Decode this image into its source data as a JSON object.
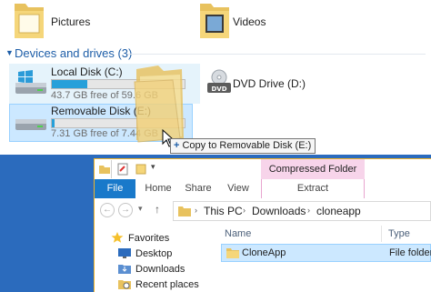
{
  "libraries": [
    {
      "label": "Pictures",
      "icon": "pictures-folder-icon"
    },
    {
      "label": "Videos",
      "icon": "videos-folder-icon"
    }
  ],
  "devices_group": {
    "title": "Devices and drives (3)"
  },
  "drives": [
    {
      "name": "Local Disk (C:)",
      "free_text": "43.7 GB free of 59.6 GB",
      "used_fraction": 0.27,
      "icon": "windows-drive-icon"
    },
    {
      "name": "DVD Drive (D:)",
      "icon": "dvd-drive-icon"
    },
    {
      "name": "Removable Disk (E:)",
      "free_text": "7.31 GB free of 7.44 GB",
      "used_fraction": 0.02,
      "icon": "removable-drive-icon"
    }
  ],
  "drag": {
    "tooltip": "Copy to Removable Disk (E:)",
    "tooltip_icon": "plus-icon"
  },
  "window": {
    "contextual_tab": "Compressed Folder Tools",
    "ribbon_tabs": [
      "File",
      "Home",
      "Share",
      "View",
      "Extract"
    ],
    "breadcrumb": [
      "This PC",
      "Downloads",
      "cloneapp"
    ],
    "nav": {
      "favorites": "Favorites",
      "items": [
        "Desktop",
        "Downloads",
        "Recent places"
      ]
    },
    "columns": {
      "name": "Name",
      "type": "Type"
    },
    "rows": [
      {
        "name": "CloneApp",
        "type": "File folder"
      }
    ]
  },
  "colors": {
    "accent": "#1979ca",
    "selection": "#cce8ff",
    "context_tab": "#f7d4ea",
    "group_header": "#1e5ea8"
  }
}
